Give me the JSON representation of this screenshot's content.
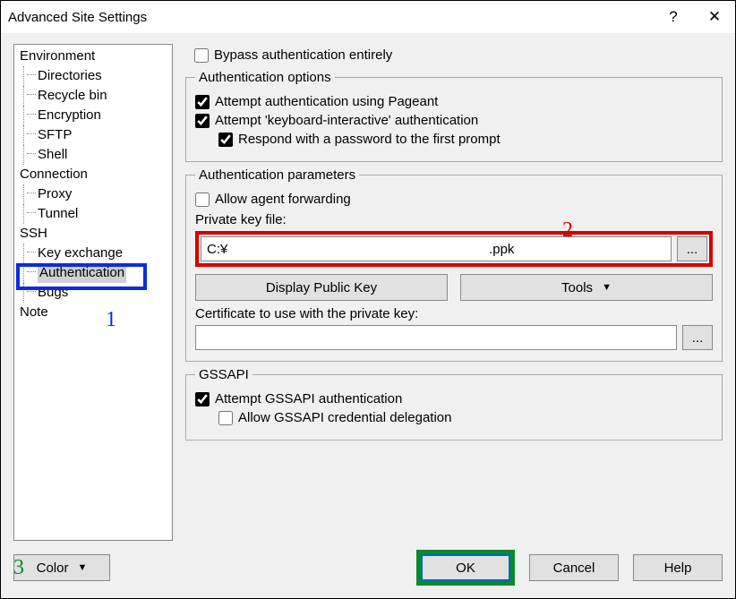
{
  "window": {
    "title": "Advanced Site Settings"
  },
  "tree": {
    "environment": "Environment",
    "directories": "Directories",
    "recycle_bin": "Recycle bin",
    "encryption": "Encryption",
    "sftp": "SFTP",
    "shell": "Shell",
    "connection": "Connection",
    "proxy": "Proxy",
    "tunnel": "Tunnel",
    "ssh": "SSH",
    "key_exchange": "Key exchange",
    "authentication": "Authentication",
    "bugs": "Bugs",
    "note": "Note"
  },
  "top": {
    "bypass": "Bypass authentication entirely"
  },
  "auth_options": {
    "legend": "Authentication options",
    "pageant": "Attempt authentication using Pageant",
    "ki": "Attempt 'keyboard-interactive' authentication",
    "respond_pw": "Respond with a password to the first prompt"
  },
  "auth_params": {
    "legend": "Authentication parameters",
    "allow_forward": "Allow agent forwarding",
    "pk_label": "Private key file:",
    "pk_value": "C:¥                                                                      .ppk",
    "browse": "...",
    "display_pk": "Display Public Key",
    "tools": "Tools",
    "cert_label": "Certificate to use with the private key:",
    "cert_value": "",
    "cert_browse": "..."
  },
  "gssapi": {
    "legend": "GSSAPI",
    "attempt": "Attempt GSSAPI authentication",
    "delegate": "Allow GSSAPI credential delegation"
  },
  "buttons": {
    "color": "Color",
    "ok": "OK",
    "cancel": "Cancel",
    "help": "Help"
  },
  "annotations": {
    "n1": "1",
    "n2": "2",
    "n3": "3"
  }
}
